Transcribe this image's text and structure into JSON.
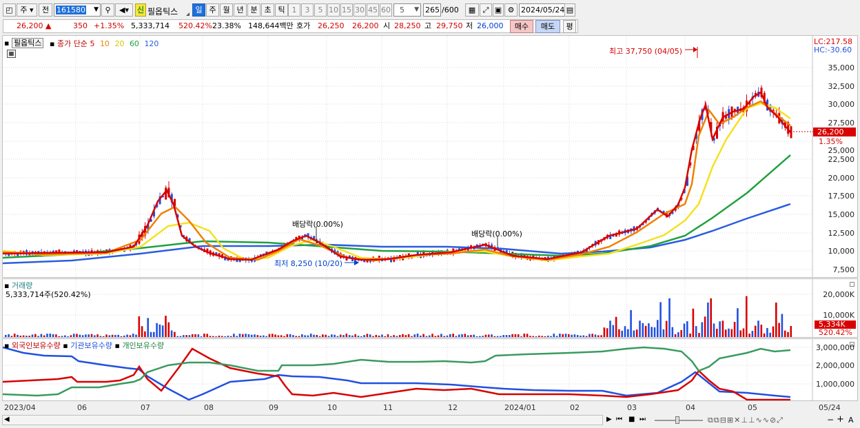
{
  "toolbar": {
    "period_unit": "주",
    "prev_label": "전",
    "stock_code": "161580",
    "stock_badge": "신",
    "stock_name": "필옵틱스",
    "periods": [
      "일",
      "주",
      "월",
      "년",
      "분",
      "초",
      "틱"
    ],
    "selected_period": "일",
    "minute_steps": [
      "1",
      "3",
      "5",
      "10",
      "15",
      "30",
      "45",
      "60"
    ],
    "custom_step": "5",
    "count": "265",
    "count_total": "/600",
    "date": "2024/05/24"
  },
  "quote": {
    "price": "26,200",
    "change_arrow": "▲",
    "change": "350",
    "change_pct": "+1.35%",
    "volume": "5,333,714",
    "volume_ratio": "520.42%",
    "turnover": "23.38%",
    "amount": "148,644백만",
    "ask_label": "호가",
    "ask": "26,250",
    "bid": "26,200",
    "open_label": "시",
    "open": "28,250",
    "high_label": "고",
    "high": "29,750",
    "low_label": "저",
    "low": "26,000",
    "buy_button": "매수",
    "sell_button": "매도",
    "eval_button": "평"
  },
  "price_panel": {
    "stock_tag": "필옵틱스",
    "legend_prefix": "종가 단순",
    "ma_periods": [
      "5",
      "10",
      "20",
      "60",
      "120"
    ],
    "ma_colors": [
      "#d80000",
      "#f08000",
      "#f0e000",
      "#20a040",
      "#2060e0"
    ],
    "lc": "LC:217.58",
    "hc": "HC:-30.60",
    "current_price_tag": "26,200",
    "current_pct_tag": "1.35%",
    "y_ticks": [
      "35,000",
      "32,500",
      "30,000",
      "27,500",
      "25,000",
      "22,500",
      "20,000",
      "17,500",
      "15,000",
      "12,500",
      "10,000",
      "7,500"
    ],
    "high_annotation": "최고 37,750 (04/05)",
    "low_annotation": "최저 8,250 (10/20)",
    "dividend_1": "배당락(0.00%)",
    "dividend_2": "배당락(0.00%)"
  },
  "volume_panel": {
    "title": "거래량",
    "value": "5,333,714주(520.42%)",
    "y_ticks": [
      "20,000K",
      "10,000K"
    ],
    "current_tag": "5,334K",
    "current_pct": "520.42%"
  },
  "holding_panel": {
    "legend": [
      "외국인보유수량",
      "기관보유수량",
      "개인보유수량"
    ],
    "legend_colors": [
      "#d80000",
      "#2050e0",
      "#20a040"
    ],
    "y_ticks": [
      "3,000,000",
      "2,000,000",
      "1,000,000"
    ]
  },
  "x_axis": {
    "labels": [
      "2023/04",
      "06",
      "07",
      "08",
      "09",
      "10",
      "11",
      "12",
      "2024/01",
      "02",
      "03",
      "04",
      "05"
    ],
    "right_label": "05/24"
  }
}
